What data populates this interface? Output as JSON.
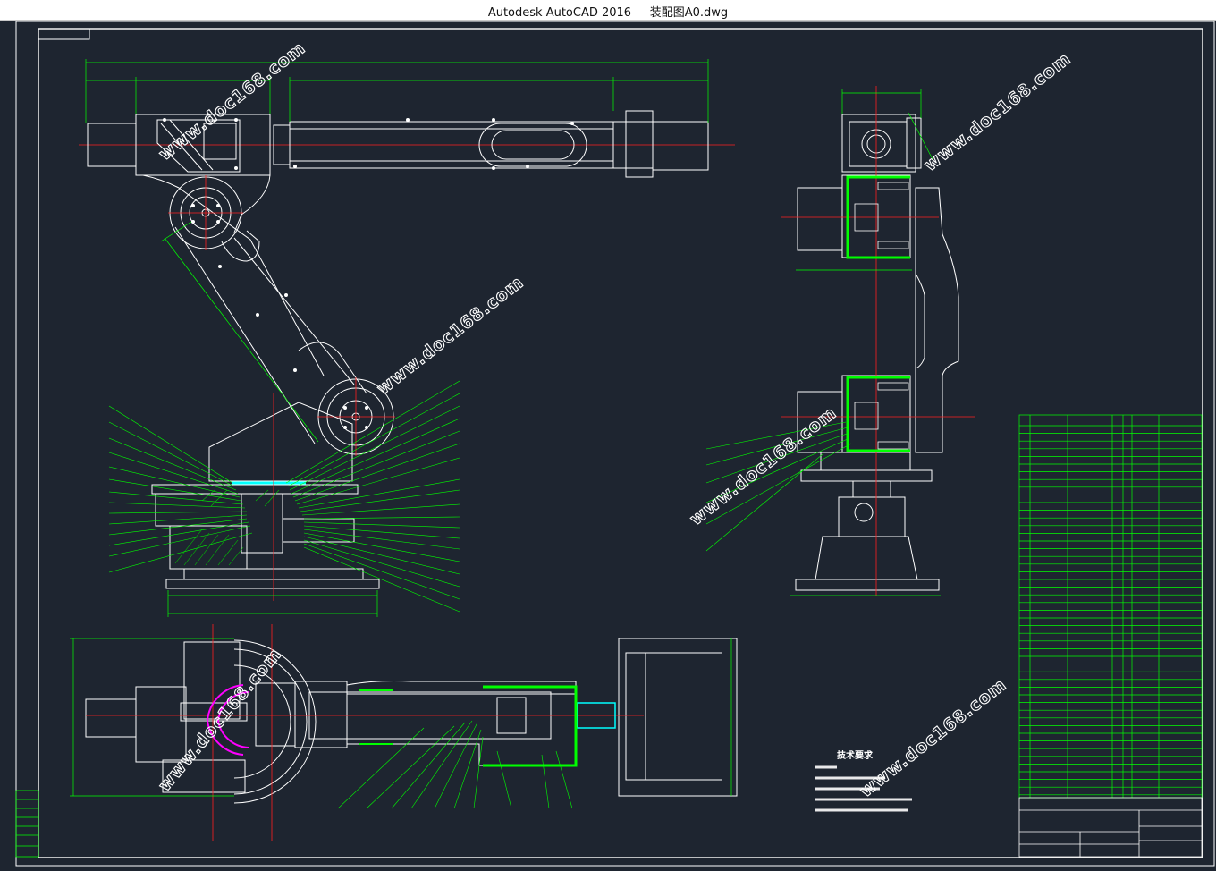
{
  "window": {
    "app_name": "Autodesk AutoCAD 2016",
    "file_name": "装配图A0.dwg",
    "title": "Autodesk AutoCAD 2016     装配图A0.dwg"
  },
  "drawing": {
    "watermark_text": "www.doc168.com",
    "tech_requirements": {
      "title": "技术要求"
    }
  },
  "colors": {
    "background": "#1e2530",
    "outline": "#ffffff",
    "dimension": "#00ff00",
    "centerline": "#ff2020",
    "leader": "#00ff00",
    "hatch": "#00c800",
    "magenta": "#ff00ff",
    "cyan": "#00ffff",
    "label": "#ffff00"
  }
}
